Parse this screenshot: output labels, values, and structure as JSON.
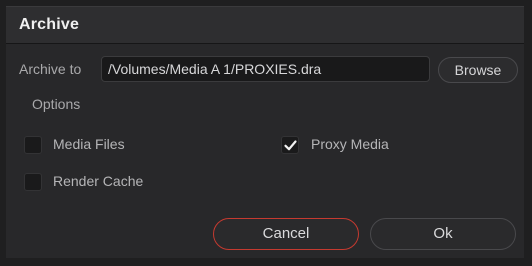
{
  "dialog": {
    "title": "Archive"
  },
  "archive_to": {
    "label": "Archive to",
    "path": "/Volumes/Media A 1/PROXIES.dra",
    "browse_label": "Browse"
  },
  "options": {
    "heading": "Options",
    "items": [
      {
        "label": "Media Files",
        "checked": false
      },
      {
        "label": "Proxy Media",
        "checked": true
      },
      {
        "label": "Render Cache",
        "checked": false
      }
    ]
  },
  "actions": {
    "cancel_label": "Cancel",
    "ok_label": "Ok"
  },
  "colors": {
    "cancel_border": "#c53a30",
    "background": "#28282a"
  },
  "icons": {
    "check": "checkmark-icon"
  }
}
